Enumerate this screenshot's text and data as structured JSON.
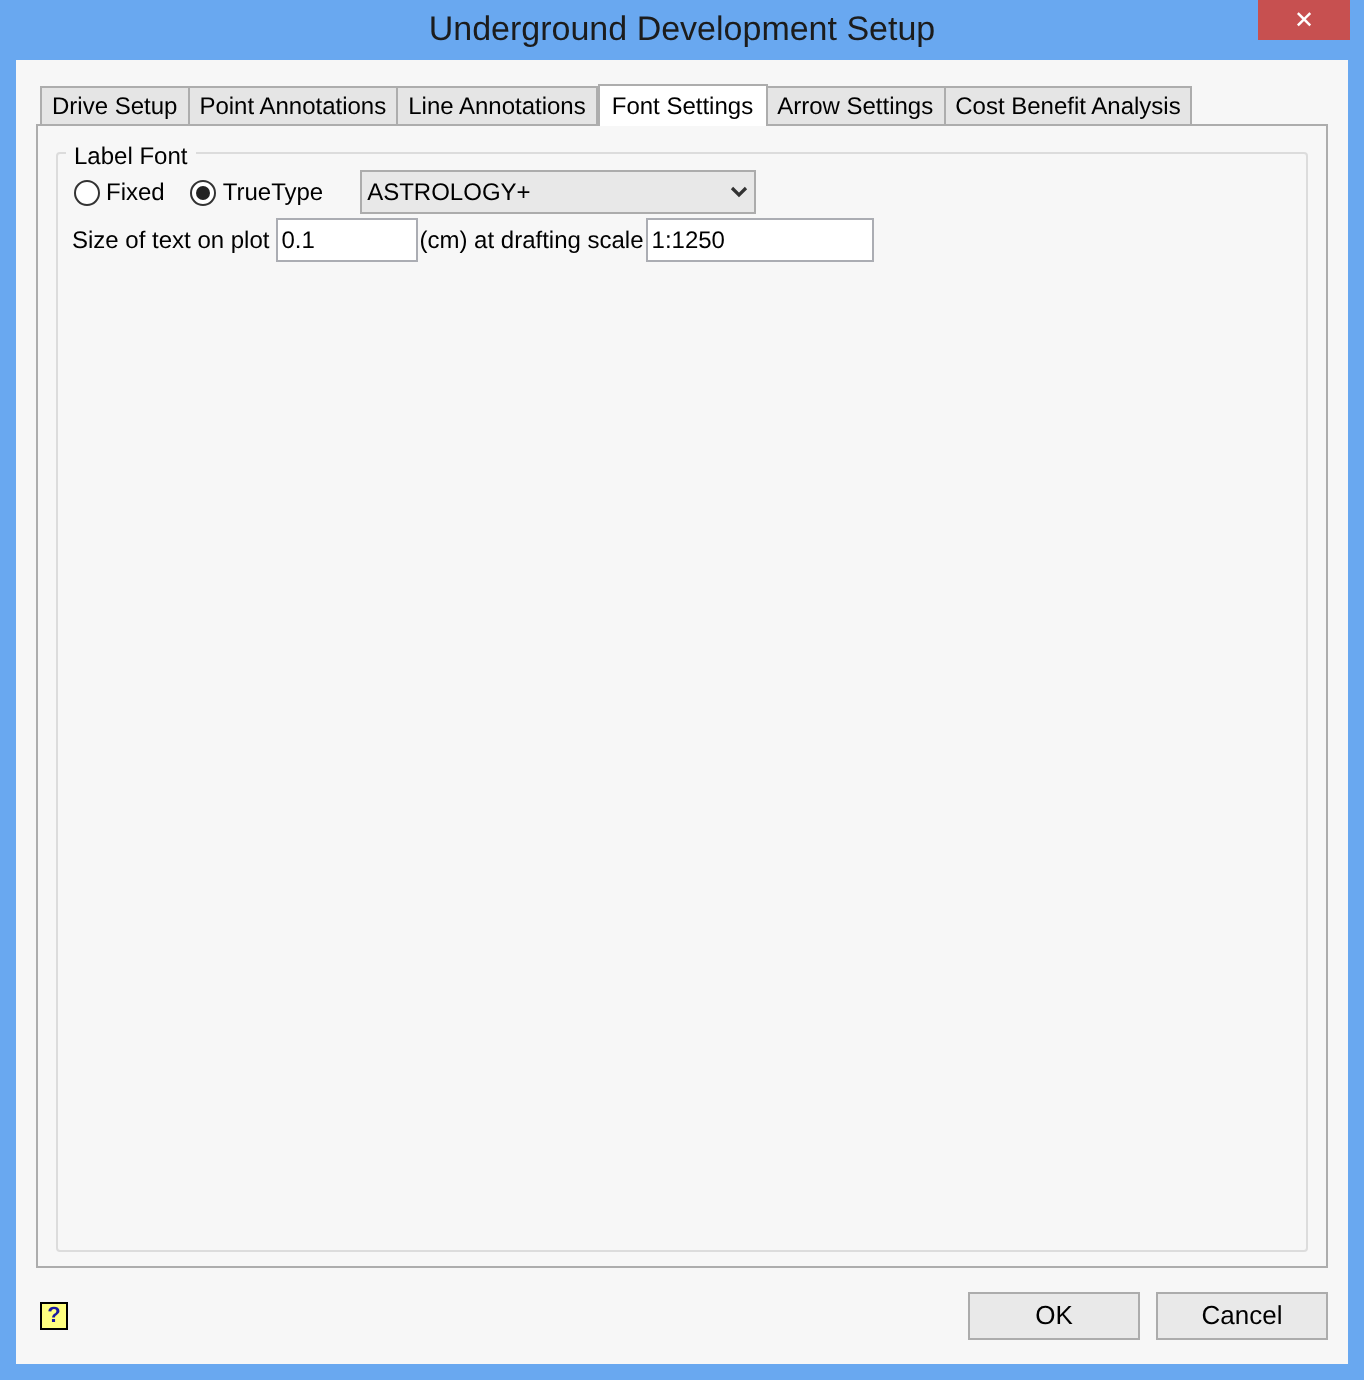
{
  "window": {
    "title": "Underground Development Setup",
    "close": "✕"
  },
  "tabs": [
    {
      "label": "Drive Setup",
      "selected": false
    },
    {
      "label": "Point Annotations",
      "selected": false
    },
    {
      "label": "Line Annotations",
      "selected": false
    },
    {
      "label": "Font Settings",
      "selected": true
    },
    {
      "label": "Arrow Settings",
      "selected": false
    },
    {
      "label": "Cost Benefit Analysis",
      "selected": false
    }
  ],
  "label_font": {
    "title": "Label Font",
    "radios": [
      {
        "label": "Fixed",
        "selected": false
      },
      {
        "label": "TrueType",
        "selected": true
      }
    ],
    "font_select": {
      "value": "ASTROLOGY+"
    },
    "size_label": "Size of text on plot",
    "size_value": "0.1",
    "scale_label": "(cm) at drafting scale",
    "scale_value": "1:1250"
  },
  "help": "?",
  "buttons": [
    "OK",
    "Cancel"
  ]
}
